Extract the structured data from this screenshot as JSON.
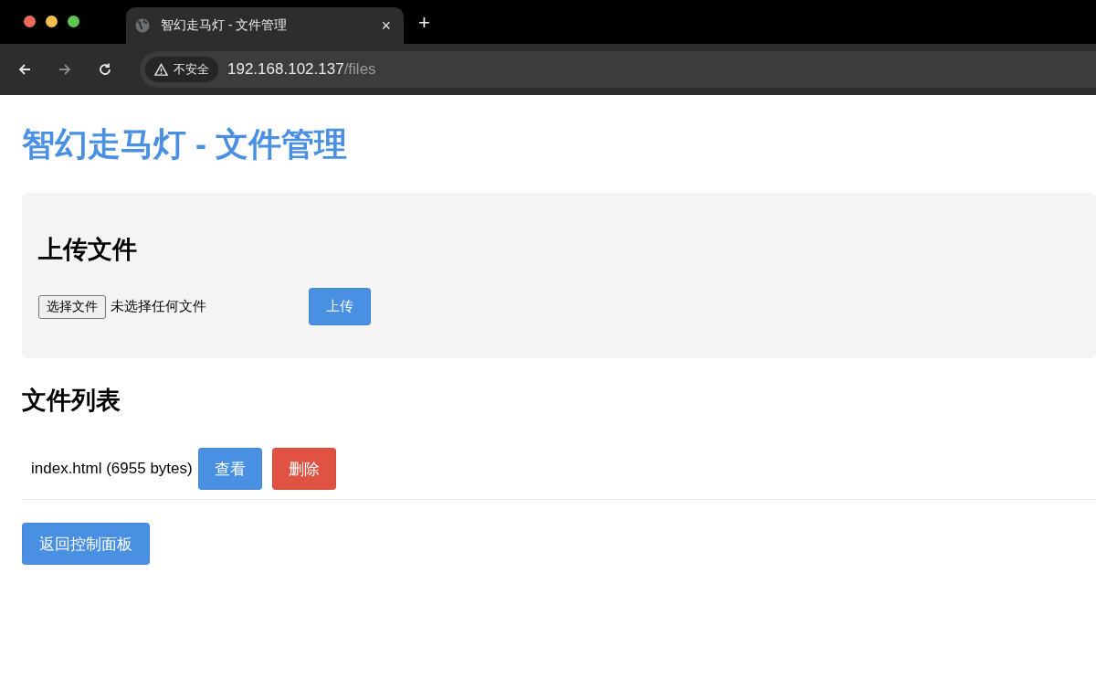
{
  "browser": {
    "tab": {
      "title": "智幻走马灯 - 文件管理",
      "selected": true
    },
    "new_tab": "+",
    "close": "×",
    "security": "不安全",
    "url_host": "192.168.102.137",
    "url_path": "/files"
  },
  "page": {
    "title": "智幻走马灯 - 文件管理",
    "upload": {
      "heading": "上传文件",
      "choose_button": "选择文件",
      "no_file": "未选择任何文件",
      "submit": "上传"
    },
    "list": {
      "heading": "文件列表",
      "files": [
        {
          "label": "index.html (6955 bytes)",
          "actions": [
            {
              "label": "查看",
              "kind": "view"
            },
            {
              "label": "删除",
              "kind": "delete"
            }
          ]
        }
      ]
    },
    "back_button": "返回控制面板"
  }
}
